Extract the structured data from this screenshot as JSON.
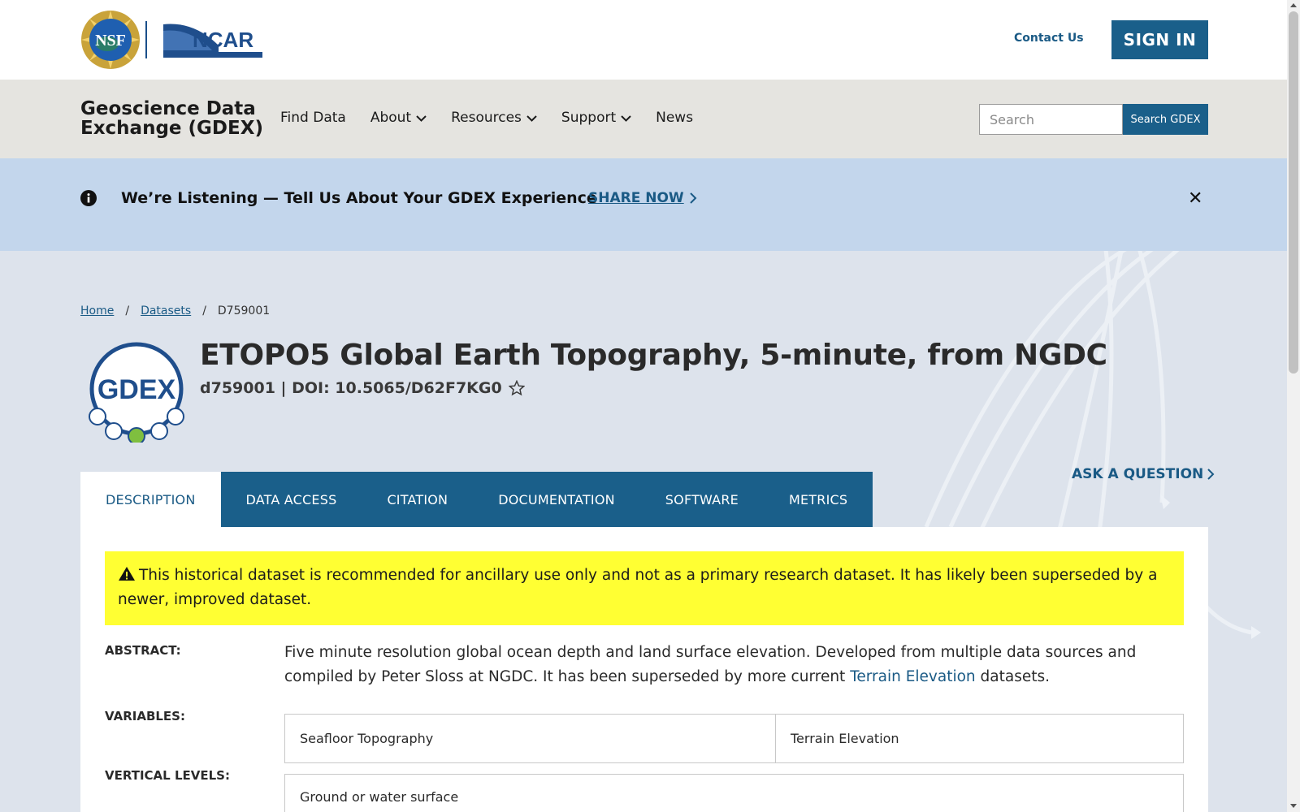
{
  "header": {
    "contact_label": "Contact Us",
    "signin_label": "SIGN IN",
    "nsf_logo_text": "NSF",
    "ncar_logo_text": "NCAR"
  },
  "nav": {
    "site_title": "Geoscience Data Exchange (GDEX)",
    "items": [
      {
        "label": "Find Data",
        "dropdown": false
      },
      {
        "label": "About",
        "dropdown": true
      },
      {
        "label": "Resources",
        "dropdown": true
      },
      {
        "label": "Support",
        "dropdown": true
      },
      {
        "label": "News",
        "dropdown": false
      }
    ],
    "search_placeholder": "Search",
    "search_button": "Search GDEX"
  },
  "banner": {
    "text": "We’re Listening — Tell Us About Your GDEX Experience",
    "link_label": "SHARE NOW",
    "close_label": "✕"
  },
  "breadcrumb": {
    "home": "Home",
    "datasets": "Datasets",
    "current": "D759001",
    "separator": "/"
  },
  "dataset": {
    "logo_text": "GDEX",
    "title": "ETOPO5 Global Earth Topography, 5-minute, from NGDC",
    "subtitle": "d759001 | DOI: 10.5065/D62F7KG0",
    "ask_label": "ASK A QUESTION"
  },
  "tabs": [
    {
      "label": "DESCRIPTION",
      "active": true
    },
    {
      "label": "DATA ACCESS",
      "active": false
    },
    {
      "label": "CITATION",
      "active": false
    },
    {
      "label": "DOCUMENTATION",
      "active": false
    },
    {
      "label": "SOFTWARE",
      "active": false
    },
    {
      "label": "METRICS",
      "active": false
    }
  ],
  "content": {
    "warning": "This historical dataset is recommended for ancillary use only and not as a primary research dataset. It has likely been superseded by a newer, improved dataset.",
    "abstract_label": "ABSTRACT:",
    "abstract_text_1": "Five minute resolution global ocean depth and land surface elevation. Developed from multiple data sources and compiled by Peter Sloss at NGDC. It has been superseded by more current ",
    "abstract_link": "Terrain Elevation",
    "abstract_text_2": " datasets.",
    "variables_label": "VARIABLES:",
    "variables": [
      "Seafloor Topography",
      "Terrain Elevation"
    ],
    "levels_label": "VERTICAL LEVELS:",
    "levels": "Ground or water surface"
  },
  "colors": {
    "primary": "#1a5f8a",
    "link": "#1a5a85",
    "banner_bg": "#c3d6ec",
    "navbar_bg": "#e5e4e0",
    "hero_bg": "#dde3ec",
    "warning_bg": "#ffff33"
  }
}
